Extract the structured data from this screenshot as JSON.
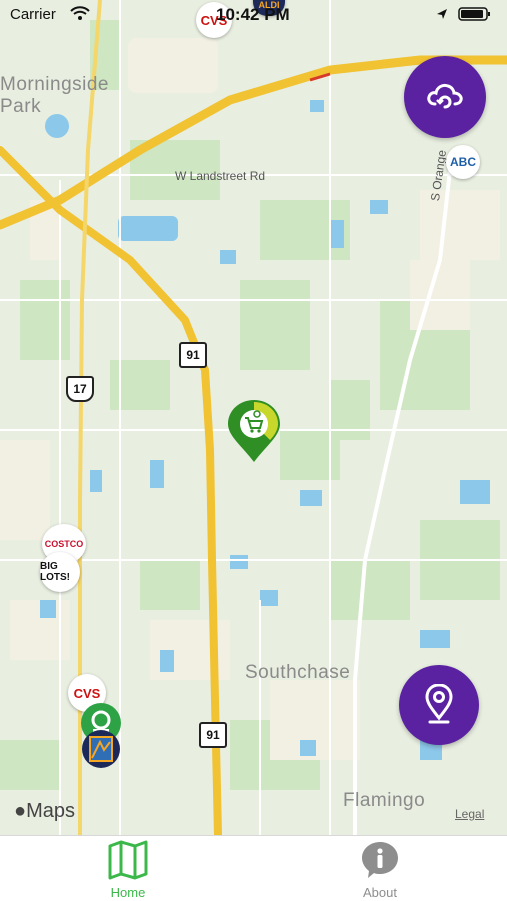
{
  "status_bar": {
    "carrier": "Carrier",
    "time": "10:42 PM",
    "icons": [
      "wifi-icon",
      "location-arrow-icon",
      "battery-icon"
    ]
  },
  "map": {
    "places": [
      "Morningside\nPark",
      "Southchase",
      "Flamingo"
    ],
    "roads": [
      "W Landstreet Rd",
      "S Orange"
    ],
    "shields": [
      "91",
      "17",
      "91"
    ],
    "attribution": "Maps",
    "legal": "Legal"
  },
  "markers": {
    "store_logos": [
      "CVS",
      "ALDI",
      "COSTCO",
      "BIG LOTS!",
      "ABC",
      "CVS"
    ],
    "selected_pin_icon": "cart-icon"
  },
  "buttons": {
    "top_right_icon": "cloud-refresh-icon",
    "bottom_right_icon": "location-pin-icon"
  },
  "tabs": [
    {
      "label": "Home",
      "icon": "map-icon",
      "active": true
    },
    {
      "label": "About",
      "icon": "info-icon",
      "active": false
    }
  ],
  "colors": {
    "accent": "#5a22a1",
    "tab_active": "#3cb84a",
    "tab_inactive": "#8e8e8e",
    "pin_green": "#3a9a2a",
    "pin_yellow": "#c7d72a"
  }
}
